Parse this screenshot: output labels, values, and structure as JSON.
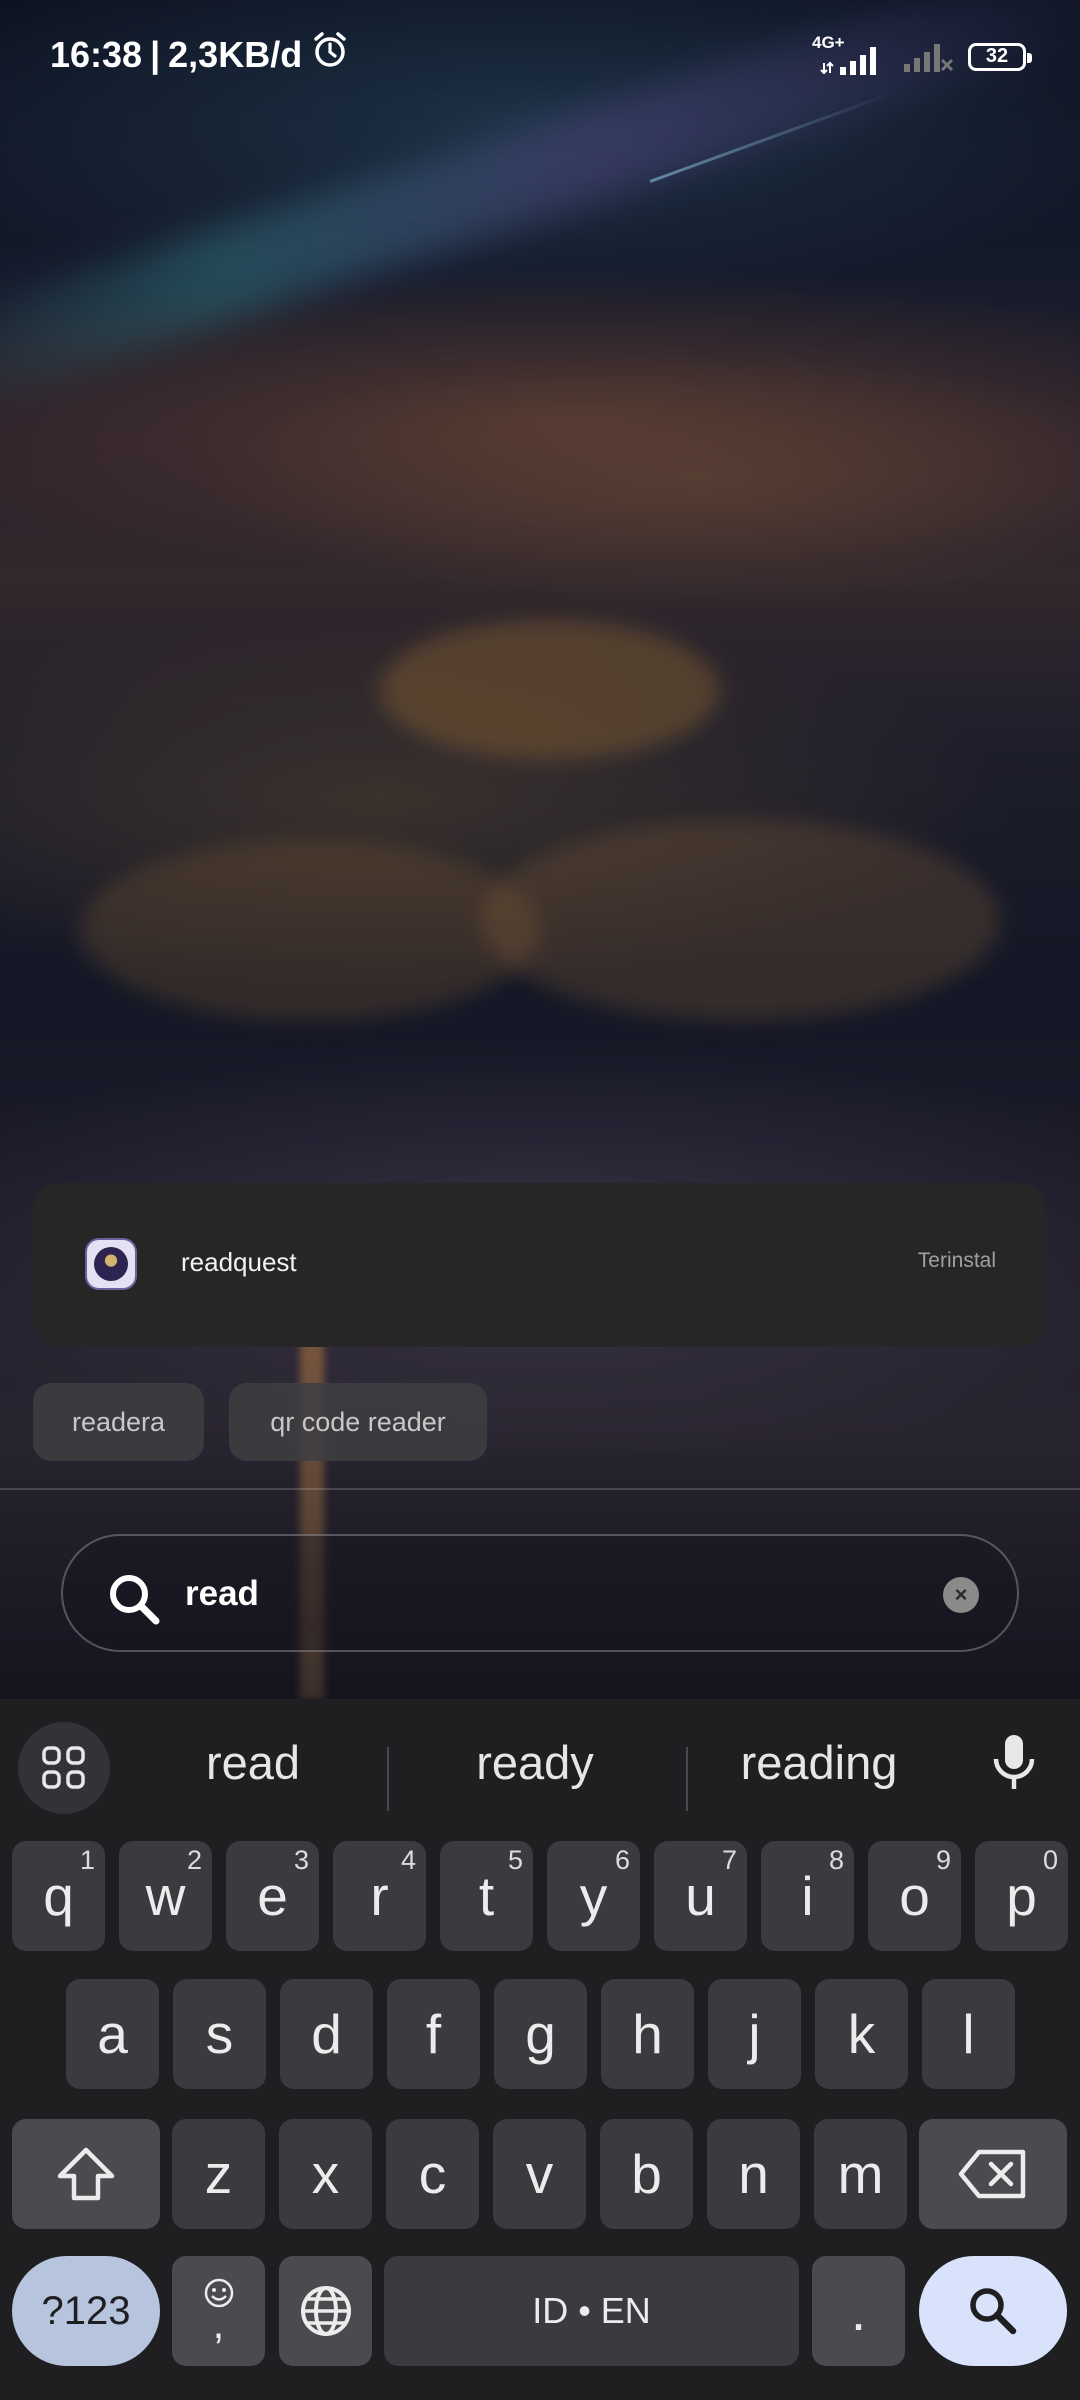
{
  "status_bar": {
    "time": "16:38",
    "separator": "|",
    "data_rate": "2,3KB/d",
    "network_type": "4G+",
    "battery": "32"
  },
  "search_result": {
    "app_name": "readquest",
    "app_status": "Terinstal"
  },
  "suggestion_chips": [
    "readera",
    "qr code reader"
  ],
  "search_bar": {
    "query": "read",
    "clear_icon": "×"
  },
  "keyboard": {
    "word_suggestions": [
      "read",
      "ready",
      "reading"
    ],
    "row1": [
      {
        "key": "q",
        "hint": "1"
      },
      {
        "key": "w",
        "hint": "2"
      },
      {
        "key": "e",
        "hint": "3"
      },
      {
        "key": "r",
        "hint": "4"
      },
      {
        "key": "t",
        "hint": "5"
      },
      {
        "key": "y",
        "hint": "6"
      },
      {
        "key": "u",
        "hint": "7"
      },
      {
        "key": "i",
        "hint": "8"
      },
      {
        "key": "o",
        "hint": "9"
      },
      {
        "key": "p",
        "hint": "0"
      }
    ],
    "row2": [
      "a",
      "s",
      "d",
      "f",
      "g",
      "h",
      "j",
      "k",
      "l"
    ],
    "row3": [
      "z",
      "x",
      "c",
      "v",
      "b",
      "n",
      "m"
    ],
    "symbols_label": "?123",
    "comma_label": ",",
    "space_label": "ID • EN",
    "period_label": "."
  },
  "colors": {
    "card_bg": "#262626",
    "keyboard_bg": "#1f1f22",
    "key_bg": "#3b3b3f",
    "search_key_bg": "#d9e2fb",
    "symbols_key_bg": "#b7c4de"
  }
}
